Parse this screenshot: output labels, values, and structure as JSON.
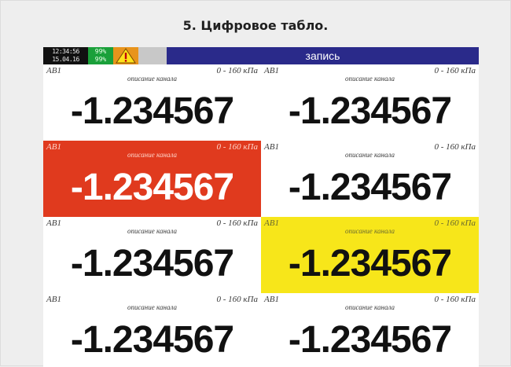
{
  "page": {
    "title": "5. Цифровое табло."
  },
  "statusbar": {
    "clock_line1": "12:34:56",
    "clock_line2": "15.04.16",
    "memory_line1": "99%",
    "memory_line2": "99%",
    "warning_icon": "warning-triangle-icon",
    "record_label": "запись"
  },
  "cells": [
    {
      "tag": "AB1",
      "range": "0 - 160 кПа",
      "desc": "описание канала",
      "value": "-1.234567",
      "state": "normal"
    },
    {
      "tag": "AB1",
      "range": "0 - 160 кПа",
      "desc": "описание канала",
      "value": "-1.234567",
      "state": "normal"
    },
    {
      "tag": "AB1",
      "range": "0 - 160 кПа",
      "desc": "описание канала",
      "value": "-1.234567",
      "state": "alarm"
    },
    {
      "tag": "AB1",
      "range": "0 - 160 кПа",
      "desc": "описание канала",
      "value": "-1.234567",
      "state": "normal"
    },
    {
      "tag": "AB1",
      "range": "0 - 160 кПа",
      "desc": "описание канала",
      "value": "-1.234567",
      "state": "normal"
    },
    {
      "tag": "AB1",
      "range": "0 - 160 кПа",
      "desc": "описание канала",
      "value": "-1.234567",
      "state": "warning"
    },
    {
      "tag": "AB1",
      "range": "0 - 160 кПа",
      "desc": "описание канала",
      "value": "-1.234567",
      "state": "normal"
    },
    {
      "tag": "AB1",
      "range": "0 - 160 кПа",
      "desc": "описание канала",
      "value": "-1.234567",
      "state": "normal"
    }
  ],
  "colors": {
    "alarm": "#e03a1e",
    "warning": "#f7e61a",
    "record_bar": "#2a2a8a",
    "memory": "#1aa03a"
  }
}
